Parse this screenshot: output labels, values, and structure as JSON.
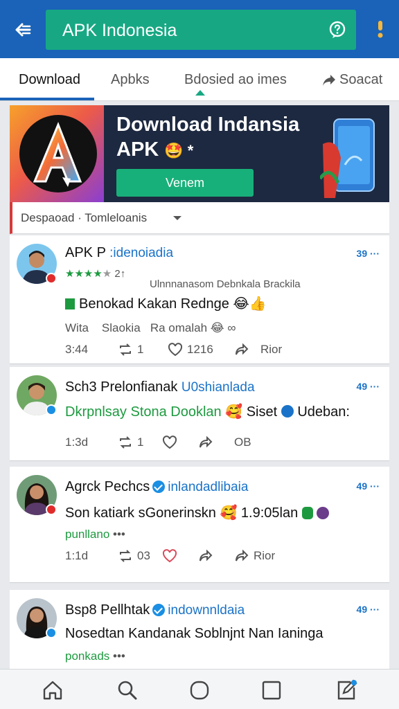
{
  "appbar": {
    "title": "APK Indonesia",
    "back_icon": "arrow-left-icon",
    "help_icon": "question-bubble-icon",
    "more_icon": "more-vertical-icon",
    "colors": {
      "bar": "#1a63b8",
      "search": "#17a883"
    }
  },
  "tabs": [
    {
      "label": "Download",
      "active": true
    },
    {
      "label": "Apbks",
      "active": false
    },
    {
      "label": "Bdosied ao imes",
      "active": false
    },
    {
      "label": "Soacat",
      "active": false,
      "icon": "share-arrow-icon"
    }
  ],
  "banner": {
    "title": "Download Indansia APK",
    "emoji": "🤩 *",
    "logo_letter": "A",
    "button_label": "Venem"
  },
  "filter": {
    "label": "Despaoad · Tomleloanis"
  },
  "posts": [
    {
      "name": "APK P",
      "handle": ":idenoiadia",
      "time_badge": "39 ···",
      "rating_stars": "★★★★",
      "rating_empty": "★",
      "rating_count": "2↑",
      "subline": "Ulnnnanasom Debnkala Brackila",
      "text": "Benokad Kakan Rednge",
      "text_emoji": "😂👍",
      "extra": "Wita    Slaokia   Ra omalah",
      "extra_emoji": "😂 ∞",
      "time": "3:44",
      "reposts": "1",
      "likes": "1216",
      "share_label": "Rior"
    },
    {
      "name": "Sch3 Prelonfianak",
      "handle": "U0shianlada",
      "time_badge": "49 ···",
      "text_green": "Dkrpnlsay Stona Dooklan",
      "text_rest": "Siset",
      "text_tail": "Udeban:",
      "time": "1:3d",
      "reposts": "1",
      "extra_label": "OB"
    },
    {
      "name": "Agrck Pechcs",
      "handle": "inlandadlibaia",
      "time_badge": "49 ···",
      "text": "Son katiark sGonerinskn",
      "text_tail": "1.9:05lan",
      "sub_green": "punllano",
      "more": "•••",
      "time": "1:1d",
      "reposts": "03",
      "share_label": "Rior"
    },
    {
      "name": "Bsp8 Pellhtak",
      "handle": "indownnldaia",
      "time_badge": "49 ···",
      "text": "Nosedtan Kandanak Soblnjnt Nan Ianinga",
      "sub_green": "ponkads",
      "more": "•••"
    }
  ],
  "bottomnav": [
    {
      "name": "home",
      "icon": "home-icon"
    },
    {
      "name": "search",
      "icon": "search-icon"
    },
    {
      "name": "circle",
      "icon": "circle-icon"
    },
    {
      "name": "square",
      "icon": "square-icon"
    },
    {
      "name": "compose",
      "icon": "compose-icon"
    }
  ]
}
